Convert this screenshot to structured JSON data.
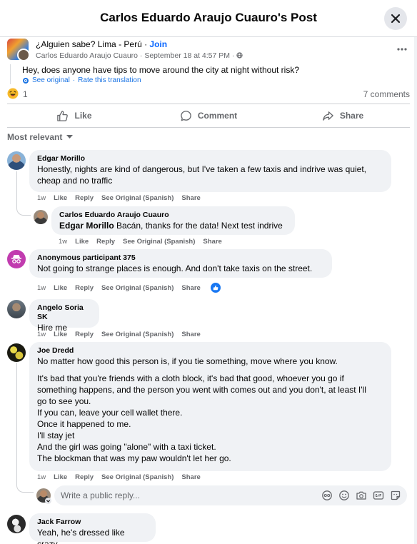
{
  "header": {
    "title": "Carlos Eduardo Araujo Cuauro's Post"
  },
  "post": {
    "group": "¿Alguien sabe? Lima - Perú",
    "dot": " · ",
    "join": "Join",
    "meta": "Carlos Eduardo Araujo Cuauro · September 18 at 4:57 PM · ",
    "text": "Hey, does anyone have tips to move around the city at night without risk?",
    "see_original": "See original",
    "rate_translation": "Rate this translation",
    "reaction_count": "1",
    "comments_count": "7 comments"
  },
  "actions": {
    "like": "Like",
    "comment": "Comment",
    "share": "Share"
  },
  "sort": {
    "label": "Most relevant"
  },
  "comment_labels": {
    "like": "Like",
    "reply": "Reply",
    "see_original": "See Original (Spanish)",
    "share": "Share"
  },
  "comments": [
    {
      "name": "Edgar Morillo",
      "time": "1w",
      "lines": [
        "Honestly, nights are kind of dangerous, but I've taken a few taxis and indrive was quiet,",
        "cheap and no traffic"
      ]
    },
    {
      "name": "Carlos Eduardo Araujo Cuauro",
      "time": "1w",
      "mention": "Edgar Morillo",
      "text": " Bacán, thanks for the data! Next test indrive"
    },
    {
      "name": "Anonymous participant 375",
      "time": "1w",
      "text": "Not going to strange places is enough. And don't take taxis on the street."
    },
    {
      "name": "Angelo Soria SK",
      "time": "1w",
      "text": "Hire me"
    },
    {
      "name": "Joe Dredd",
      "time": "1w",
      "first": "No matter how good this person is, if you tie something, move where you know.",
      "lines": [
        "It's bad that you're friends with a cloth block, it's bad that good, whoever you go if",
        "something happens, and the person you went with comes out and you don't, at least I'll",
        "go to see you.",
        "If you can, leave your cell wallet there.",
        "Once it happened to me.",
        "I'll stay jet",
        "And the girl was going \"alone\" with a taxi ticket.",
        "The blockman that was my paw wouldn't let her go."
      ]
    },
    {
      "name": "Jack Farrow",
      "text": "Yeah, he's dressed like crazy."
    }
  ],
  "reply_box": {
    "placeholder": "Write a public reply..."
  },
  "colors": {
    "accent": "#0866ff",
    "bubble": "#f0f2f5",
    "muted": "#65676b"
  }
}
